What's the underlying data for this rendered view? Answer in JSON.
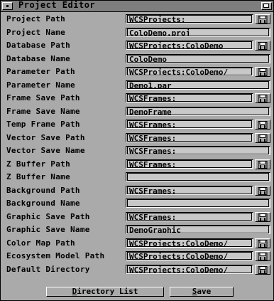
{
  "window": {
    "title": "Project Editor"
  },
  "rows": [
    {
      "label": "Project Path",
      "value": "WCSProjects:",
      "has_button": true
    },
    {
      "label": "Project Name",
      "value": "ColoDemo.proj",
      "has_button": false
    },
    {
      "label": "Database Path",
      "value": "WCSProjects:ColoDemo",
      "has_button": true
    },
    {
      "label": "Database Name",
      "value": "ColoDemo",
      "has_button": false
    },
    {
      "label": "Parameter Path",
      "value": "WCSProjects:ColoDemo/",
      "has_button": true
    },
    {
      "label": "Parameter Name",
      "value": "Demo1.par",
      "has_button": false
    },
    {
      "label": "Frame Save Path",
      "value": "WCSFrames:",
      "has_button": true
    },
    {
      "label": "Frame Save Name",
      "value": "DemoFrame",
      "has_button": false
    },
    {
      "label": "Temp Frame Path",
      "value": "WCSFrames:",
      "has_button": true
    },
    {
      "label": "Vector Save Path",
      "value": "WCSFrames:",
      "has_button": true
    },
    {
      "label": "Vector Save Name",
      "value": "WCSFrames:",
      "has_button": false
    },
    {
      "label": "Z Buffer Path",
      "value": "WCSFrames:",
      "has_button": true
    },
    {
      "label": "Z Buffer Name",
      "value": "",
      "has_button": false
    },
    {
      "label": "Background Path",
      "value": "WCSFrames:",
      "has_button": true
    },
    {
      "label": "Background Name",
      "value": "",
      "has_button": false
    },
    {
      "label": "Graphic Save Path",
      "value": "WCSFrames:",
      "has_button": true
    },
    {
      "label": "Graphic Save Name",
      "value": "DemoGraphic",
      "has_button": false
    },
    {
      "label": "Color Map Path",
      "value": "WCSProjects:ColoDemo/",
      "has_button": true
    },
    {
      "label": "Ecosystem Model Path",
      "value": "WCSProjects:ColoDemo/",
      "has_button": true
    },
    {
      "label": "Default Directory",
      "value": "WCSProjects:ColoDemo/",
      "has_button": true
    }
  ],
  "buttons": {
    "directory_list": {
      "hotkey": "D",
      "rest": "irectory List"
    },
    "save": {
      "hotkey": "S",
      "rest": "ave"
    }
  },
  "icons": {
    "browse": "file-requester-icon",
    "close": "close-gadget-icon",
    "depth": "depth-gadget-icon"
  }
}
